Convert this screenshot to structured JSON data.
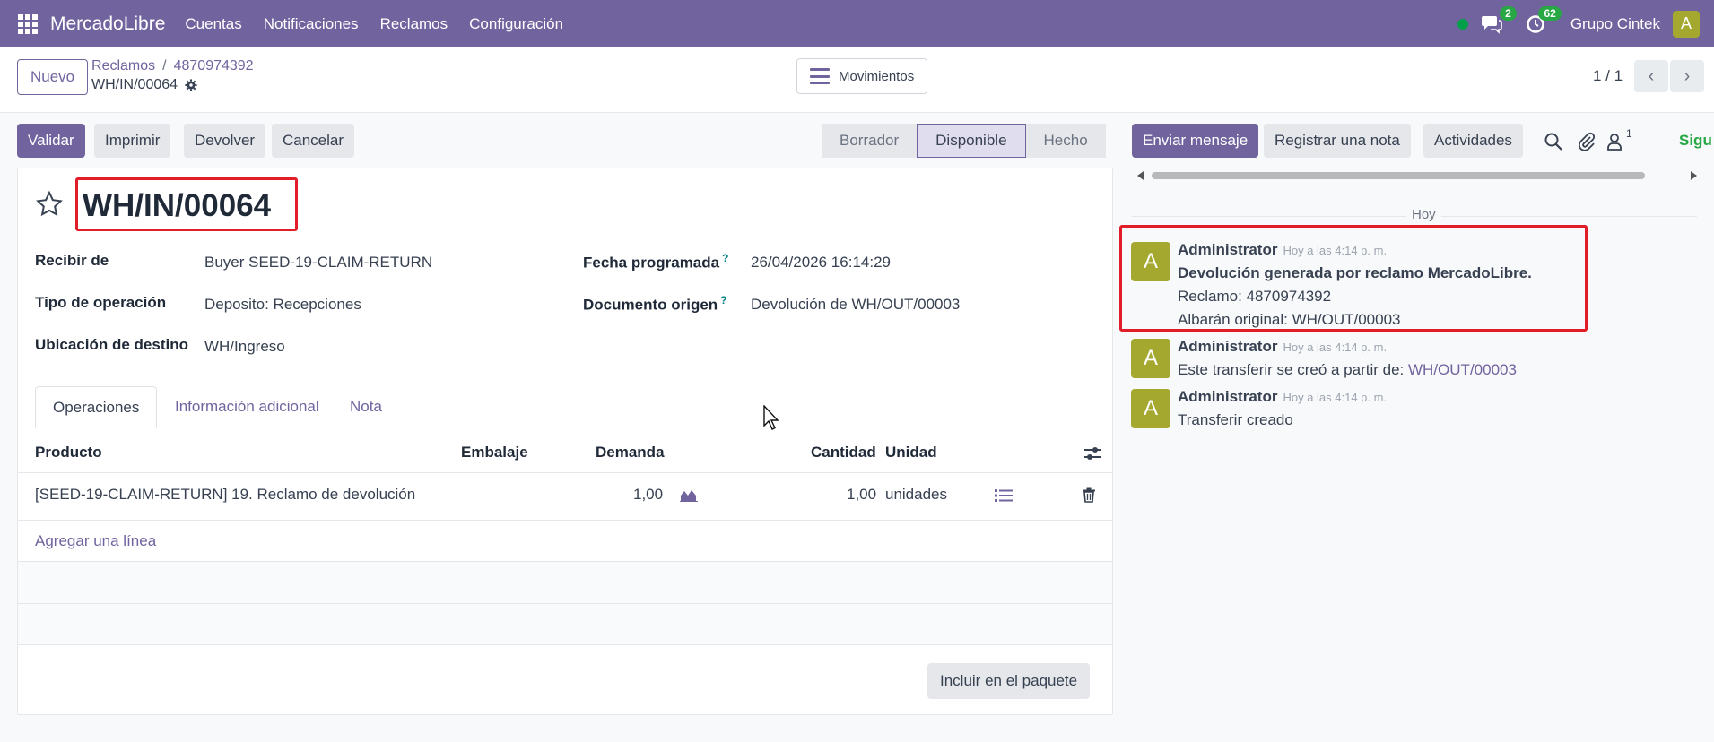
{
  "navbar": {
    "brand": "MercadoLibre",
    "menu": [
      "Cuentas",
      "Notificaciones",
      "Reclamos",
      "Configuración"
    ],
    "messages_badge": "2",
    "activities_badge": "62",
    "company": "Grupo Cintek",
    "user_initial": "A"
  },
  "control": {
    "new_label": "Nuevo",
    "breadcrumb_parent": "Reclamos",
    "breadcrumb_sep": "/",
    "breadcrumb_record": "4870974392",
    "record_name": "WH/IN/00064",
    "movements_label": "Movimientos",
    "pager": "1 / 1"
  },
  "actions": {
    "validate": "Validar",
    "print": "Imprimir",
    "return": "Devolver",
    "cancel": "Cancelar"
  },
  "status": {
    "stages": [
      "Borrador",
      "Disponible",
      "Hecho"
    ],
    "active": "Disponible"
  },
  "form": {
    "title": "WH/IN/00064",
    "fields": {
      "receive_from_label": "Recibir de",
      "receive_from": "Buyer SEED-19-CLAIM-RETURN",
      "operation_type_label": "Tipo de operación",
      "operation_type": "Deposito: Recepciones",
      "destination_label": "Ubicación de destino",
      "destination": "WH/Ingreso",
      "scheduled_label": "Fecha programada",
      "scheduled": "26/04/2026 16:14:29",
      "origin_label": "Documento origen",
      "origin": "Devolución de WH/OUT/00003",
      "help_mark": "?"
    },
    "tabs": [
      "Operaciones",
      "Información adicional",
      "Nota"
    ],
    "table": {
      "headers": {
        "product": "Producto",
        "packaging": "Embalaje",
        "demand": "Demanda",
        "quantity": "Cantidad",
        "unit": "Unidad"
      },
      "rows": [
        {
          "product": "[SEED-19-CLAIM-RETURN] 19. Reclamo de devolución",
          "demand": "1,00",
          "quantity": "1,00",
          "unit": "unidades"
        }
      ],
      "add_line": "Agregar una línea"
    },
    "include_package": "Incluir en el paquete"
  },
  "chatter": {
    "send_message": "Enviar mensaje",
    "log_note": "Registrar una nota",
    "activities": "Activities",
    "activities_label": "Actividades",
    "followers_count": "1",
    "follow_label": "Sigu",
    "today": "Hoy",
    "messages": [
      {
        "author": "Administrator",
        "time": "Hoy a las 4:14 p. m.",
        "initial": "A",
        "title": "Devolución generada por reclamo MercadoLibre.",
        "line1": "Reclamo: 4870974392",
        "line2": "Albarán original: WH/OUT/00003"
      },
      {
        "author": "Administrator",
        "time": "Hoy a las 4:14 p. m.",
        "initial": "A",
        "text": "Este transferir se creó a partir de:",
        "link": "WH/OUT/00003"
      },
      {
        "author": "Administrator",
        "time": "Hoy a las 4:14 p. m.",
        "initial": "A",
        "text": "Transferir creado"
      }
    ]
  },
  "colors": {
    "brand": "#71639e",
    "highlight": "#e11d2a",
    "avatar": "#a5a82e",
    "online": "#00a04a"
  }
}
